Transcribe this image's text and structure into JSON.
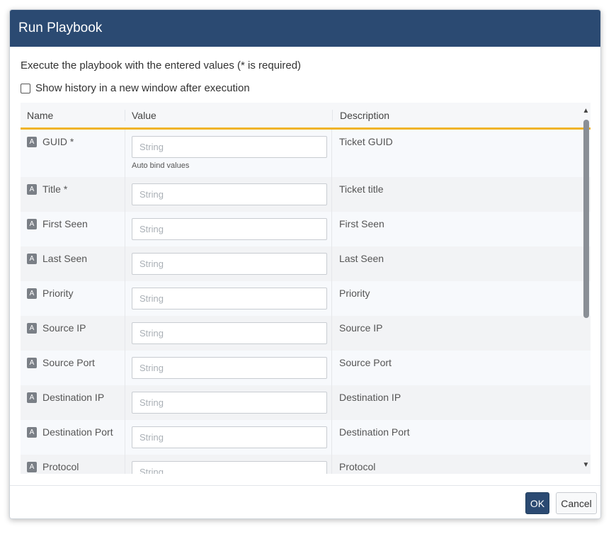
{
  "dialog": {
    "title": "Run Playbook",
    "intro": "Execute the playbook with the entered values (* is required)",
    "history_label": "Show history in a new window after execution",
    "history_checked": false
  },
  "table": {
    "headers": {
      "name": "Name",
      "value": "Value",
      "description": "Description"
    },
    "rows": [
      {
        "type": "A",
        "name": "GUID *",
        "placeholder": "String",
        "value": "",
        "hint": "Auto bind values",
        "description": "Ticket GUID"
      },
      {
        "type": "A",
        "name": "Title *",
        "placeholder": "String",
        "value": "",
        "hint": "",
        "description": "Ticket title"
      },
      {
        "type": "A",
        "name": "First Seen",
        "placeholder": "String",
        "value": "",
        "hint": "",
        "description": "First Seen"
      },
      {
        "type": "A",
        "name": "Last Seen",
        "placeholder": "String",
        "value": "",
        "hint": "",
        "description": "Last Seen"
      },
      {
        "type": "A",
        "name": "Priority",
        "placeholder": "String",
        "value": "",
        "hint": "",
        "description": "Priority"
      },
      {
        "type": "A",
        "name": "Source IP",
        "placeholder": "String",
        "value": "",
        "hint": "",
        "description": "Source IP"
      },
      {
        "type": "A",
        "name": "Source Port",
        "placeholder": "String",
        "value": "",
        "hint": "",
        "description": "Source Port"
      },
      {
        "type": "A",
        "name": "Destination IP",
        "placeholder": "String",
        "value": "",
        "hint": "",
        "description": "Destination IP"
      },
      {
        "type": "A",
        "name": "Destination Port",
        "placeholder": "String",
        "value": "",
        "hint": "",
        "description": "Destination Port"
      },
      {
        "type": "A",
        "name": "Protocol",
        "placeholder": "String",
        "value": "",
        "hint": "",
        "description": "Protocol"
      }
    ]
  },
  "scrollbar": {
    "up_icon": "triangle-up-icon",
    "down_icon": "triangle-down-icon"
  },
  "footer": {
    "ok_label": "OK",
    "cancel_label": "Cancel"
  },
  "colors": {
    "header_bg": "#2b4a72",
    "accent_line": "#f0b429",
    "ok_bg": "#2b4a72"
  }
}
